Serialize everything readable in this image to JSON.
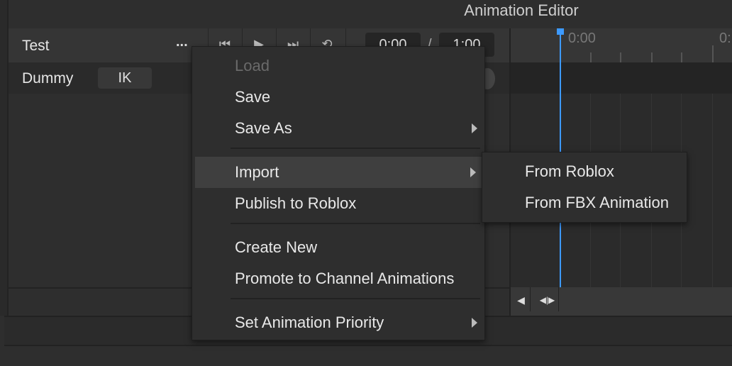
{
  "window": {
    "title": "Animation Editor"
  },
  "toolbar": {
    "animation_name": "Test",
    "more_label": "...",
    "current_time": "0:00",
    "time_separator": "/",
    "end_time": "1:00"
  },
  "rig": {
    "name": "Dummy",
    "ik_label": "IK"
  },
  "timeline": {
    "ruler_labels": [
      "0:00",
      "0:"
    ],
    "playhead_color": "#3d9aff"
  },
  "menu": {
    "items": [
      {
        "label": "Load",
        "disabled": true
      },
      {
        "label": "Save"
      },
      {
        "label": "Save As",
        "submenu": true
      },
      {
        "label": "Import",
        "submenu": true,
        "highlighted": true
      },
      {
        "label": "Publish to Roblox"
      },
      {
        "label": "Create New"
      },
      {
        "label": "Promote to Channel Animations"
      },
      {
        "label": "Set Animation Priority",
        "submenu": true
      }
    ]
  },
  "submenu": {
    "items": [
      {
        "label": "From Roblox"
      },
      {
        "label": "From FBX Animation"
      }
    ]
  }
}
